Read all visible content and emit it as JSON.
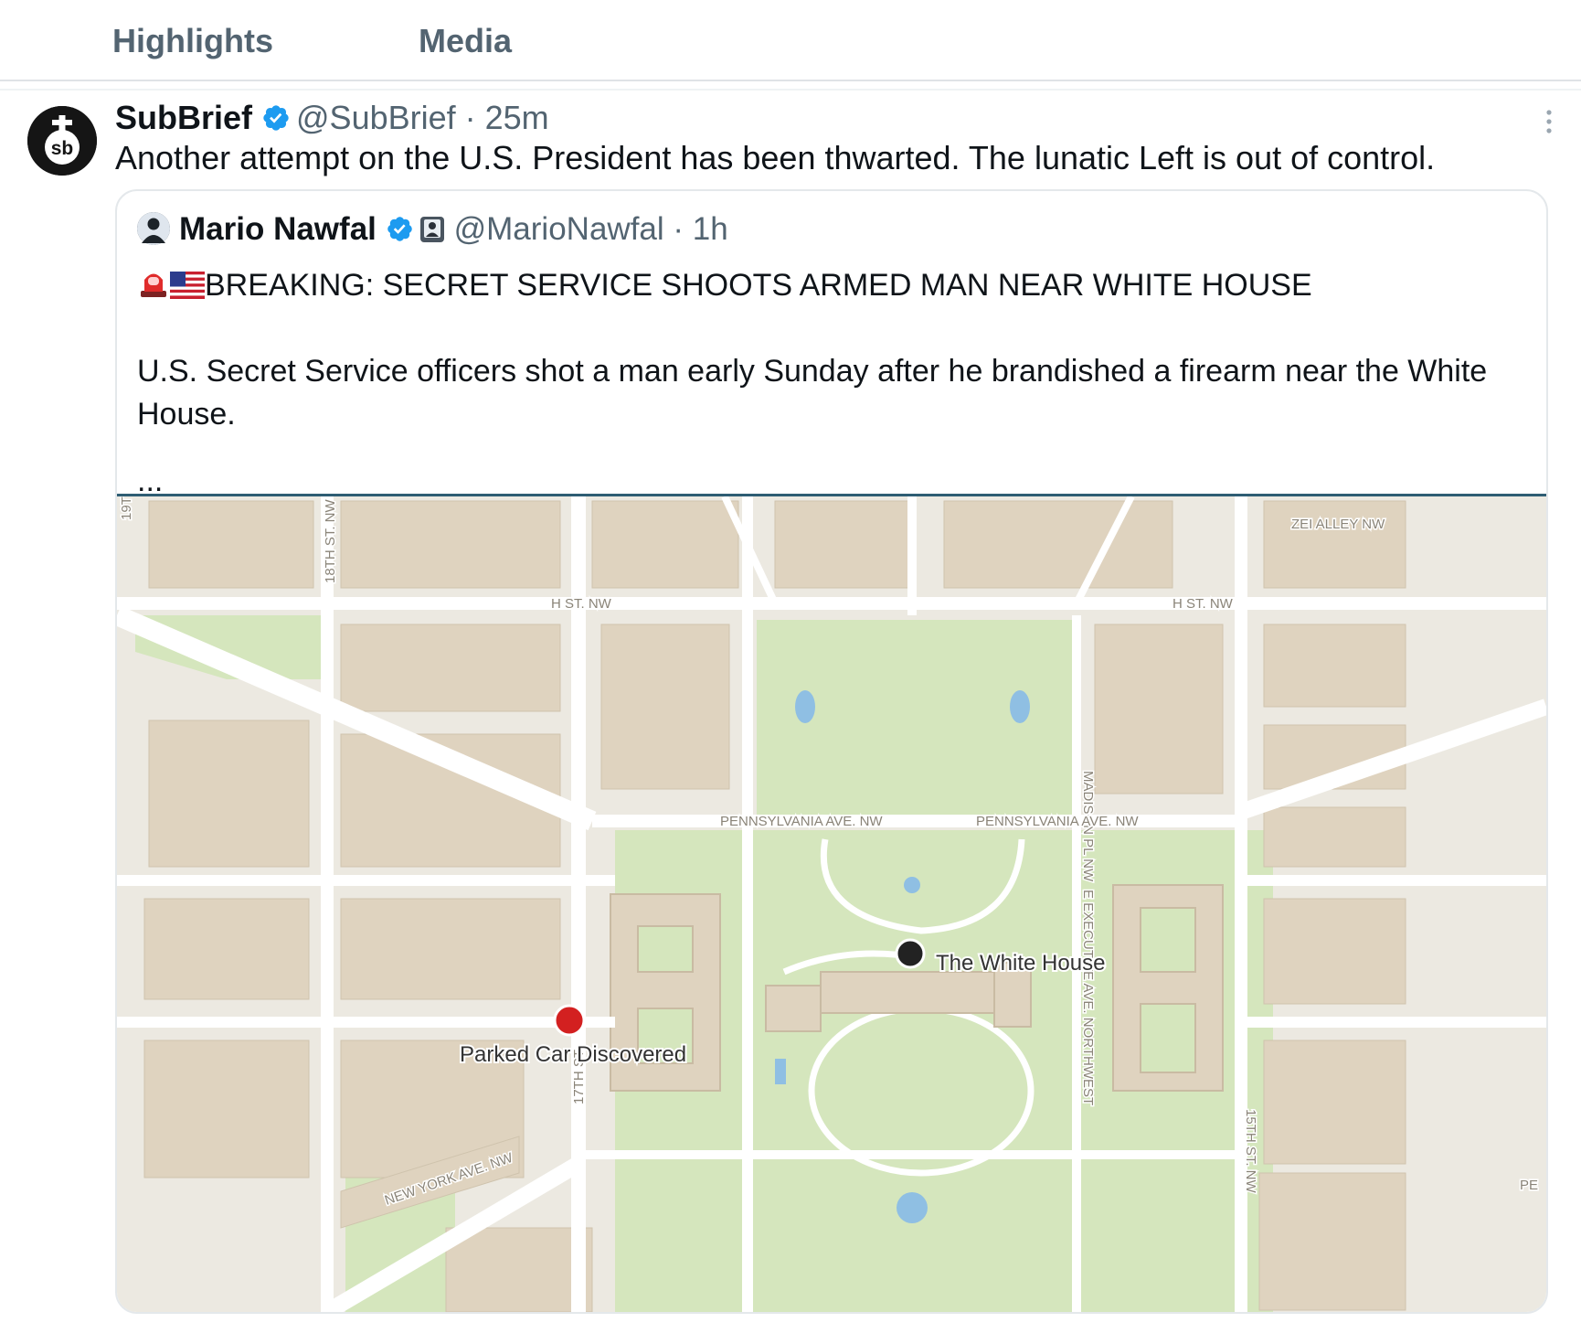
{
  "tabs": [
    {
      "label": "Highlights"
    },
    {
      "label": "Media"
    }
  ],
  "post": {
    "author_name": "SubBrief",
    "handle": "@SubBrief",
    "time": "25m",
    "text": "Another attempt on the U.S. President has been thwarted. The lunatic Left is out of control.",
    "avatar_text": "sb"
  },
  "quote": {
    "author_name": "Mario Nawfal",
    "handle": "@MarioNawfal",
    "time": "1h",
    "headline": "BREAKING: SECRET SERVICE SHOOTS ARMED MAN NEAR WHITE HOUSE",
    "body": "U.S. Secret Service officers shot a man early Sunday after he brandished a firearm near the White House.",
    "ellipsis": "..."
  },
  "map": {
    "street_labels": {
      "h_st_left": "H ST. NW",
      "h_st_right": "H ST. NW",
      "zei_alley": "ZEI ALLEY NW",
      "eighteenth": "18TH ST. NW",
      "madison": "MADISON PL NW",
      "penn_left": "PENNSYLVANIA AVE. NW",
      "penn_right": "PENNSYLVANIA AVE. NW",
      "executive": "E EXECUTIVE AVE. NORTHWEST",
      "seventeenth": "17TH ST",
      "new_york": "NEW YORK AVE. NW",
      "fifteenth": "15TH ST. NW",
      "edge_19th": "19T",
      "edge_pe": "PE"
    },
    "markers": [
      {
        "label": "The White House",
        "color": "#222222"
      },
      {
        "label": "Parked Car Discovered",
        "color": "#d32020"
      }
    ],
    "colors": {
      "block": "#dfd3bf",
      "road": "#ffffff",
      "park": "#d5e6bd",
      "water": "#8fbfe3",
      "base": "#ece9e1"
    }
  },
  "colors": {
    "verified": "#1d9bf0",
    "muted": "#536471"
  }
}
